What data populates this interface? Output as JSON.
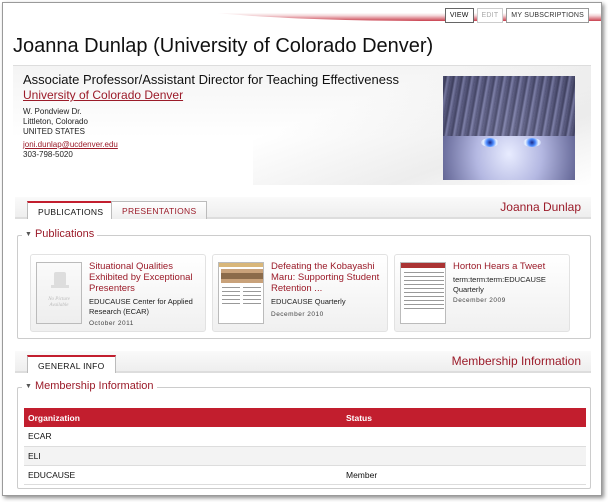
{
  "top_tabs": [
    {
      "label": "VIEW"
    },
    {
      "label": "EDIT"
    },
    {
      "label": "MY SUBSCRIPTIONS"
    }
  ],
  "page_title": "Joanna Dunlap (University of Colorado Denver)",
  "profile": {
    "job_title": "Associate Professor/Assistant Director for Teaching Effectiveness",
    "institution": "University of Colorado Denver",
    "address": [
      "W. Pondview Dr.",
      "Littleton, Colorado",
      "UNITED STATES"
    ],
    "email": "joni.dunlap@ucdenver.edu",
    "phone": "303-798-5020"
  },
  "content_tabs": {
    "tabs": [
      {
        "label": "PUBLICATIONS"
      },
      {
        "label": "PRESENTATIONS"
      }
    ],
    "right_title": "Joanna Dunlap"
  },
  "publications": {
    "legend": "Publications",
    "items": [
      {
        "title": "Situational Qualities Exhibited by Exceptional Presenters",
        "source": "EDUCAUSE Center for Applied Research (ECAR)",
        "date": "October 2011",
        "thumb_text": "No Picture Available"
      },
      {
        "title": "Defeating the Kobayashi Maru: Supporting Student Retention ...",
        "source": "EDUCAUSE Quarterly",
        "date": "December 2010"
      },
      {
        "title": "Horton Hears a Tweet",
        "source": "term:term:term:EDUCAUSE Quarterly",
        "date": "December 2009"
      }
    ]
  },
  "info_tabs": {
    "tabs": [
      {
        "label": "GENERAL INFO"
      }
    ],
    "right_title": "Membership Information"
  },
  "membership": {
    "legend": "Membership Information",
    "columns": [
      "Organization",
      "Status"
    ],
    "rows": [
      {
        "organization": "ECAR",
        "status": ""
      },
      {
        "organization": "ELI",
        "status": ""
      },
      {
        "organization": "EDUCAUSE",
        "status": "Member"
      }
    ]
  },
  "colors": {
    "accent": "#c21e2e",
    "link": "#9b1b29"
  }
}
